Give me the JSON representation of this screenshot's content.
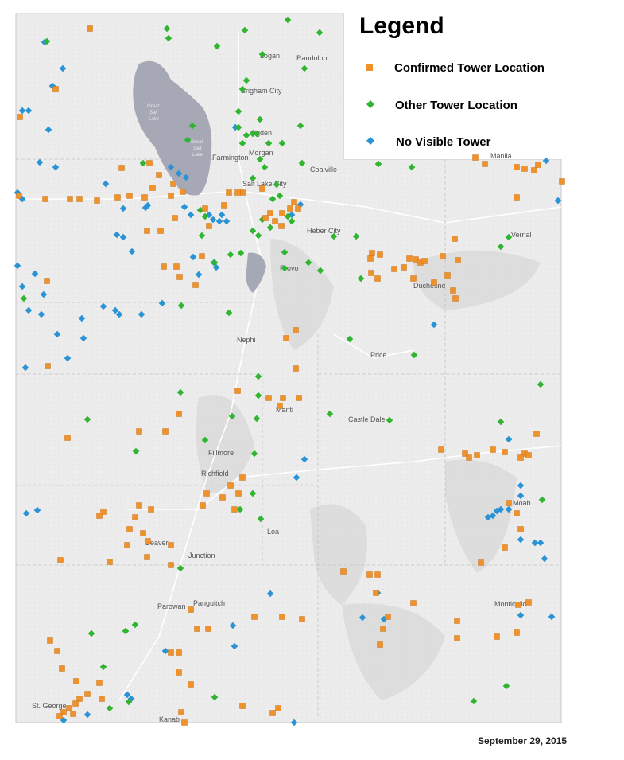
{
  "legend": {
    "title": "Legend",
    "items": [
      {
        "label": "Confirmed Tower Location",
        "symbol": "square",
        "color": "#f0922b"
      },
      {
        "label": "Other Tower Location",
        "symbol": "diamond",
        "color": "#2fb52f"
      },
      {
        "label": "No Visible Tower",
        "symbol": "diamond",
        "color": "#2a93d5"
      }
    ]
  },
  "date": "September 29, 2015",
  "colors": {
    "confirmed": "#f0922b",
    "other": "#2fb52f",
    "none": "#2a93d5",
    "land": "#ececec",
    "lake": "#a6a9b5"
  },
  "lake_labels": [
    "Great",
    "Salt",
    "Lake"
  ],
  "cities": [
    "Logan",
    "Randolph",
    "Brigham City",
    "Ogden",
    "Morgan",
    "Farmington",
    "Coalville",
    "Salt Lake City",
    "Manila",
    "Heber City",
    "Vernal",
    "Provo",
    "Duchesne",
    "Nephi",
    "Price",
    "Manti",
    "Castle Dale",
    "Fillmore",
    "Richfield",
    "Moab",
    "Loa",
    "Beaver",
    "Junction",
    "Parowan",
    "Panguitch",
    "Monticello",
    "St. George",
    "Kanab"
  ]
}
